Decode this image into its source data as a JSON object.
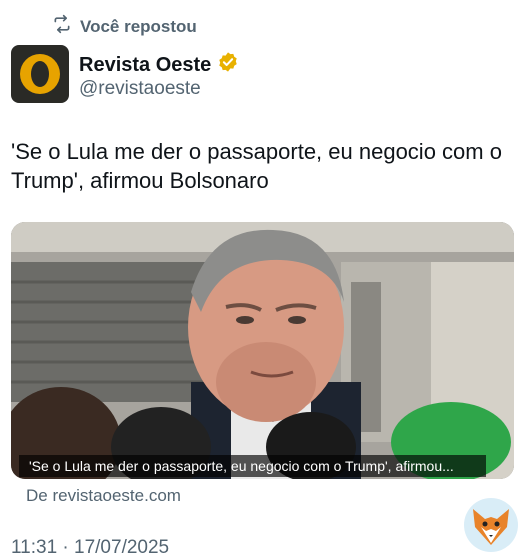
{
  "repost": {
    "icon": "repost-icon",
    "label": "Você repostou"
  },
  "author": {
    "name": "Revista Oeste",
    "handle": "@revistaoeste",
    "verified_icon": "verified-badge-icon",
    "avatar_color": "#e7a300"
  },
  "tweet": {
    "text": "'Se o Lula me der o passaporte, eu negocio com o Trump', afirmou Bolsonaro"
  },
  "card": {
    "caption": "'Se o Lula me der o passaporte, eu negocio com o Trump', afirmou...",
    "source": "De revistaoeste.com"
  },
  "meta": {
    "timestamp": "11:31 · 17/07/2025"
  },
  "watermark": {
    "icon": "fox-logo-icon"
  }
}
